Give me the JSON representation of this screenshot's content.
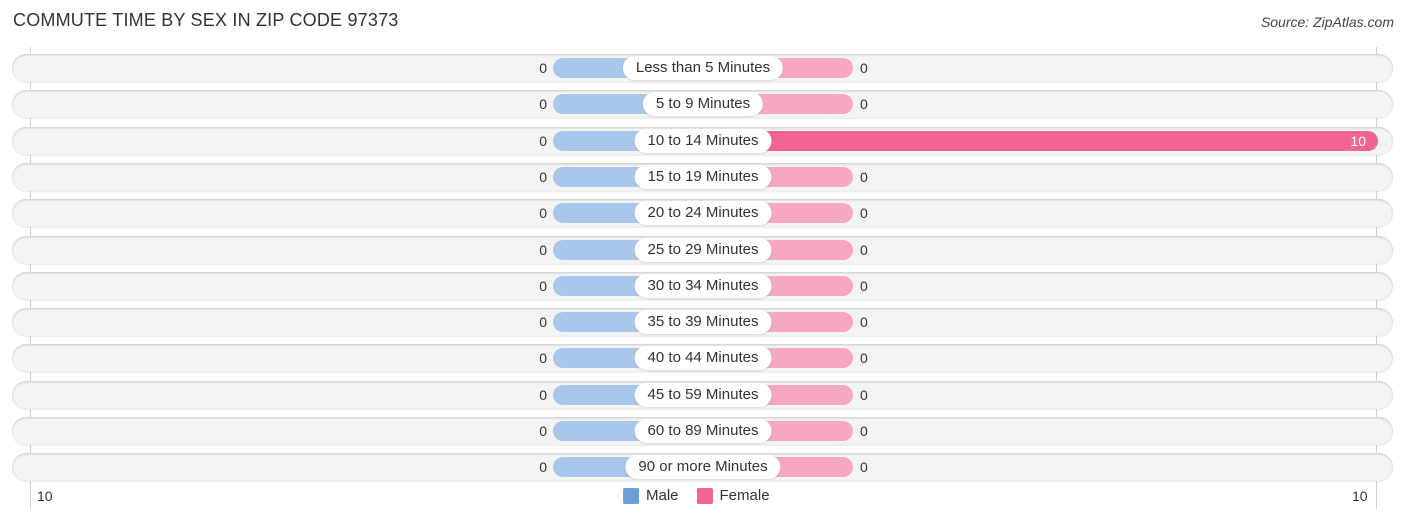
{
  "title": "COMMUTE TIME BY SEX IN ZIP CODE 97373",
  "source": "Source: ZipAtlas.com",
  "colors": {
    "male": "#a9c7ea",
    "female": "#f6a8c1",
    "female_strong": "#f26591",
    "male_legend": "#6a9fd8",
    "female_legend": "#f26591"
  },
  "chart_data": {
    "type": "bar",
    "orientation": "horizontal-diverging",
    "title": "COMMUTE TIME BY SEX IN ZIP CODE 97373",
    "categories": [
      "Less than 5 Minutes",
      "5 to 9 Minutes",
      "10 to 14 Minutes",
      "15 to 19 Minutes",
      "20 to 24 Minutes",
      "25 to 29 Minutes",
      "30 to 34 Minutes",
      "35 to 39 Minutes",
      "40 to 44 Minutes",
      "45 to 59 Minutes",
      "60 to 89 Minutes",
      "90 or more Minutes"
    ],
    "series": [
      {
        "name": "Male",
        "values": [
          0,
          0,
          0,
          0,
          0,
          0,
          0,
          0,
          0,
          0,
          0,
          0
        ]
      },
      {
        "name": "Female",
        "values": [
          0,
          0,
          10,
          0,
          0,
          0,
          0,
          0,
          0,
          0,
          0,
          0
        ]
      }
    ],
    "xlim": [
      -10,
      10
    ],
    "tick_labels": {
      "left": "10",
      "right": "10"
    },
    "legend": {
      "position": "bottom-center",
      "entries": [
        "Male",
        "Female"
      ]
    }
  }
}
